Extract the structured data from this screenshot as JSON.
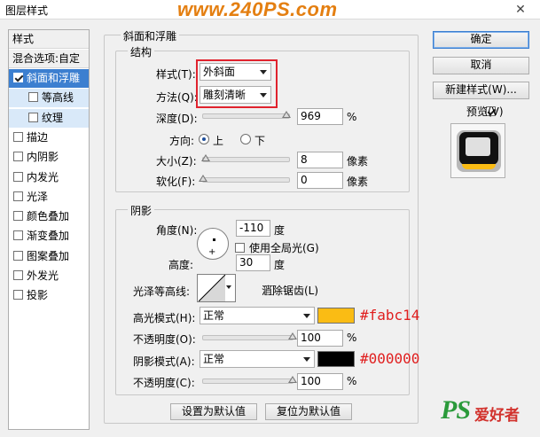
{
  "window": {
    "title": "图层样式",
    "watermark": "www.240PS.com"
  },
  "left_panel": {
    "header": "样式",
    "blend_options": "混合选项:自定",
    "items": [
      {
        "label": "斜面和浮雕",
        "checked": true,
        "selected": true
      },
      {
        "label": "等高线",
        "checked": false,
        "sub": true
      },
      {
        "label": "纹理",
        "checked": false,
        "sub": true
      },
      {
        "label": "描边",
        "checked": false
      },
      {
        "label": "内阴影",
        "checked": false
      },
      {
        "label": "内发光",
        "checked": false
      },
      {
        "label": "光泽",
        "checked": false
      },
      {
        "label": "颜色叠加",
        "checked": false
      },
      {
        "label": "渐变叠加",
        "checked": false
      },
      {
        "label": "图案叠加",
        "checked": false
      },
      {
        "label": "外发光",
        "checked": false
      },
      {
        "label": "投影",
        "checked": false
      }
    ]
  },
  "bevel": {
    "title": "斜面和浮雕",
    "structure_title": "结构",
    "style_label": "样式(T):",
    "style_value": "外斜面",
    "technique_label": "方法(Q):",
    "technique_value": "雕刻清晰",
    "depth_label": "深度(D):",
    "depth_value": "969",
    "depth_unit": "%",
    "depth_fraction": 0.97,
    "direction_label": "方向:",
    "direction_up": "上",
    "direction_down": "下",
    "size_label": "大小(Z):",
    "size_value": "8",
    "size_unit": "像素",
    "size_fraction": 0.03,
    "soften_label": "软化(F):",
    "soften_value": "0",
    "soften_unit": "像素",
    "soften_fraction": 0.0
  },
  "shading": {
    "title": "阴影",
    "angle_label": "角度(N):",
    "angle_value": "-110",
    "angle_unit": "度",
    "global_light_label": "使用全局光(G)",
    "global_light_checked": false,
    "altitude_label": "高度:",
    "altitude_value": "30",
    "altitude_unit": "度",
    "gloss_contour_label": "光泽等高线:",
    "antialiased_label": "消除锯齿(L)",
    "antialiased_checked": false,
    "highlight_mode_label": "高光模式(H):",
    "highlight_mode_value": "正常",
    "highlight_color": "#fabc14",
    "highlight_opacity_label": "不透明度(O):",
    "highlight_opacity_value": "100",
    "highlight_opacity_fraction": 1.0,
    "shadow_mode_label": "阴影模式(A):",
    "shadow_mode_value": "正常",
    "shadow_color": "#000000",
    "shadow_opacity_label": "不透明度(C):",
    "shadow_opacity_value": "100",
    "shadow_opacity_fraction": 1.0,
    "percent_unit": "%"
  },
  "annotations": {
    "highlight_hex": "#fabc14",
    "shadow_hex": "#000000"
  },
  "buttons": {
    "ok": "确定",
    "cancel": "取消",
    "new_style": "新建样式(W)...",
    "preview": "预览(V)",
    "preview_checked": true,
    "make_default": "设置为默认值",
    "reset_default": "复位为默认值"
  },
  "colors": {
    "accent": "#3c7fd0",
    "highlight_swatch": "#fabc14",
    "shadow_swatch": "#000000",
    "annotation_red": "#e01e1e",
    "watermark": "#e47f11"
  },
  "logo_text": "PS爱好者"
}
